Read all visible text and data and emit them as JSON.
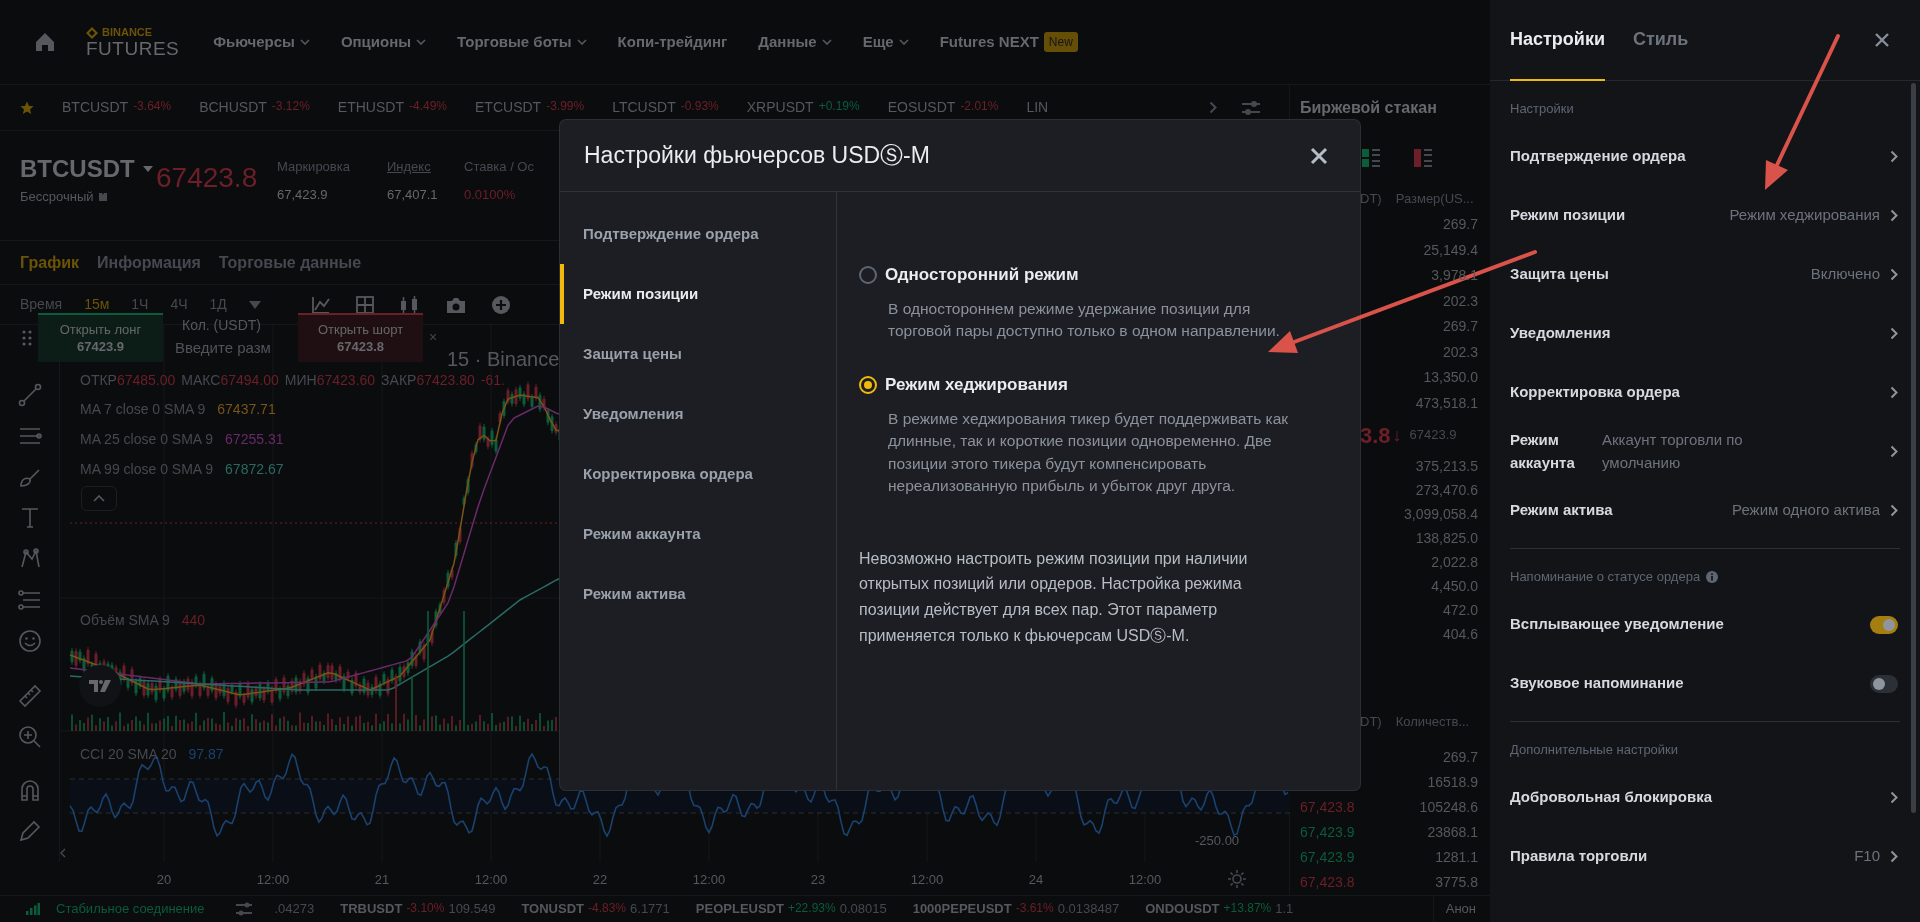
{
  "top_nav": {
    "logo": {
      "brand": "BINANCE",
      "product": "FUTURES"
    },
    "items": [
      {
        "label": "Фьючерсы",
        "dropdown": true
      },
      {
        "label": "Опционы",
        "dropdown": true
      },
      {
        "label": "Торговые боты",
        "dropdown": true
      },
      {
        "label": "Копи-трейдинг",
        "dropdown": false
      },
      {
        "label": "Данные",
        "dropdown": true
      },
      {
        "label": "Еще",
        "dropdown": true
      },
      {
        "label": "Futures NEXT",
        "dropdown": false,
        "badge": "New"
      }
    ]
  },
  "ticker_bar": {
    "items": [
      {
        "symbol": "BTCUSDT",
        "change": "-3.64%",
        "negative": true
      },
      {
        "symbol": "BCHUSDT",
        "change": "-3.12%",
        "negative": true
      },
      {
        "symbol": "ETHUSDT",
        "change": "-4.49%",
        "negative": true
      },
      {
        "symbol": "ETCUSDT",
        "change": "-3.99%",
        "negative": true
      },
      {
        "symbol": "LTCUSDT",
        "change": "-0.93%",
        "negative": true
      },
      {
        "symbol": "XRPUSDT",
        "change": "+0.19%",
        "negative": false
      },
      {
        "symbol": "EOSUSDT",
        "change": "-2.01%",
        "negative": true
      },
      {
        "symbol": "LIN"
      }
    ]
  },
  "symbol_header": {
    "symbol": "BTCUSDT",
    "contract": "Бессрочный",
    "price": "67423.8",
    "stats": [
      {
        "label": "Маркировка",
        "value": "67,423.9",
        "underlined": false,
        "negative": false
      },
      {
        "label": "Индекс",
        "value": "67,407.1",
        "underlined": true,
        "negative": false
      },
      {
        "label": "Ставка / Ос",
        "value": "0.0100%",
        "underlined": false,
        "negative": true
      }
    ]
  },
  "chart_tabs": [
    {
      "label": "График",
      "selected": true
    },
    {
      "label": "Информация",
      "selected": false
    },
    {
      "label": "Торговые данные",
      "selected": false
    }
  ],
  "intervals": [
    {
      "label": "Время",
      "selected": false
    },
    {
      "label": "15м",
      "selected": true
    },
    {
      "label": "1Ч",
      "selected": false
    },
    {
      "label": "4Ч",
      "selected": false
    },
    {
      "label": "1Д",
      "selected": false
    }
  ],
  "quick_trade": {
    "long": {
      "label": "Открыть лонг",
      "price": "67423.9"
    },
    "amount_label": "Кол. (USDT)",
    "amount_placeholder": "Введите разм",
    "short": {
      "label": "Открыть шорт",
      "price": "67423.8"
    },
    "close": "×"
  },
  "chart": {
    "title": "15 · Binance",
    "ohlc": [
      {
        "label": "ОТКР",
        "value": "67485.00"
      },
      {
        "label": "МАКС",
        "value": "67494.00"
      },
      {
        "label": "МИН",
        "value": "67423.60"
      },
      {
        "label": "ЗАКР",
        "value": "67423.80"
      }
    ],
    "change": "-61.",
    "moving_averages": [
      {
        "label": "MA 7 close 0 SMA 9",
        "value": "67437.71",
        "color": "#7a5418"
      },
      {
        "label": "MA 25 close 0 SMA 9",
        "value": "67255.31",
        "color": "#6a2a6a"
      },
      {
        "label": "MA 99 close 0 SMA 9",
        "value": "67872.67",
        "color": "#2a6a66"
      }
    ],
    "volume": {
      "label": "Объём SMA 9",
      "value": "440"
    },
    "cci": {
      "label": "CCI 20 SMA 20",
      "value": "97.87"
    },
    "axis_value": "-250.00",
    "x_labels": [
      "20",
      "12:00",
      "21",
      "12:00",
      "22",
      "12:00",
      "23",
      "12:00",
      "24",
      "12:00"
    ]
  },
  "order_book": {
    "title": "Биржевой стакан",
    "columns": [
      "DT)",
      "Размер(US..."
    ],
    "asks": [
      "269.7",
      "25,149.4",
      "3,978.1",
      "202.3",
      "269.7",
      "202.3",
      "13,350.0",
      "473,518.1"
    ],
    "mid": {
      "price": "3.8",
      "arrow": "↓",
      "mark": "67423.9"
    },
    "bids": [
      "375,213.5",
      "273,470.6",
      "3,099,058.4",
      "138,825.0",
      "2,022.8",
      "4,450.0",
      "472.0",
      "404.6"
    ]
  },
  "trades": {
    "columns": [
      "DT)",
      "Количеств..."
    ],
    "rows": [
      {
        "size": "269.7"
      },
      {
        "size": "16518.9"
      },
      {
        "price": "67,423.8",
        "size": "105248.6",
        "buy": false
      },
      {
        "price": "67,423.9",
        "size": "23868.1",
        "buy": true
      },
      {
        "price": "67,423.9",
        "size": "1281.1",
        "buy": true
      },
      {
        "price": "67,423.8",
        "size": "3775.8",
        "buy": false
      }
    ]
  },
  "status_bar": {
    "connection": "Стабильное соединение",
    "tickers": [
      {
        "price": ".04273"
      },
      {
        "symbol": "TRBUSDT",
        "change": "-3.10%",
        "negative": true,
        "price": "109.549"
      },
      {
        "symbol": "TONUSDT",
        "change": "-4.83%",
        "negative": true,
        "price": "6.1771"
      },
      {
        "symbol": "PEOPLEUSDT",
        "change": "+22.93%",
        "negative": false,
        "price": "0.08015"
      },
      {
        "symbol": "1000PEPEUSDT",
        "change": "-3.61%",
        "negative": true,
        "price": "0.0138487"
      },
      {
        "symbol": "ONDOUSDT",
        "change": "+13.87%",
        "negative": false,
        "price": "1.1"
      }
    ],
    "announcement": "Анон"
  },
  "modal": {
    "title": "Настройки фьючерсов USDⓈ-M",
    "nav": [
      {
        "label": "Подтверждение ордера",
        "selected": false
      },
      {
        "label": "Режим позиции",
        "selected": true
      },
      {
        "label": "Защита цены",
        "selected": false
      },
      {
        "label": "Уведомления",
        "selected": false
      },
      {
        "label": "Корректировка ордера",
        "selected": false
      },
      {
        "label": "Режим аккаунта",
        "selected": false
      },
      {
        "label": "Режим актива",
        "selected": false
      }
    ],
    "options": [
      {
        "title": "Односторонний режим",
        "description": "В одностороннем режиме удержание позиции для торговой пары доступно только в одном направлении.",
        "selected": false
      },
      {
        "title": "Режим хеджирования",
        "description": "В режиме хеджирования тикер будет поддерживать как длинные, так и короткие позиции одновременно. Две позиции этого тикера будут компенсировать нереализованную прибыль и убыток друг друга.",
        "selected": true
      }
    ],
    "note": "Невозможно настроить режим позиции при наличии открытых позиций или ордеров. Настройка режима позиции действует для всех пар. Этот параметр применяется только к фьючерсам USDⓈ-M."
  },
  "settings_panel": {
    "tabs": [
      {
        "label": "Настройки",
        "selected": true
      },
      {
        "label": "Стиль",
        "selected": false
      }
    ],
    "sections": [
      {
        "heading": "Настройки",
        "items": [
          {
            "kind": "link",
            "label": "Подтверждение ордера"
          },
          {
            "kind": "link",
            "label": "Режим позиции",
            "value": "Режим хеджирования"
          },
          {
            "kind": "link",
            "label": "Защита цены",
            "value": "Включено"
          },
          {
            "kind": "link",
            "label": "Уведомления"
          },
          {
            "kind": "link",
            "label": "Корректировка ордера"
          },
          {
            "kind": "link",
            "label": "Режим аккаунта",
            "value": "Аккаунт торговли по умолчанию"
          },
          {
            "kind": "link",
            "label": "Режим актива",
            "value": "Режим одного актива"
          }
        ]
      },
      {
        "heading": "Напоминание о статусе ордера",
        "info": true,
        "items": [
          {
            "kind": "toggle",
            "label": "Всплывающее уведомление",
            "on": true
          },
          {
            "kind": "toggle",
            "label": "Звуковое напоминание",
            "on": false
          }
        ]
      },
      {
        "heading": "Дополнительные настройки",
        "items": [
          {
            "kind": "link",
            "label": "Добровольная блокировка"
          },
          {
            "kind": "link",
            "label": "Правила торговли",
            "value": "F10"
          }
        ]
      }
    ]
  }
}
